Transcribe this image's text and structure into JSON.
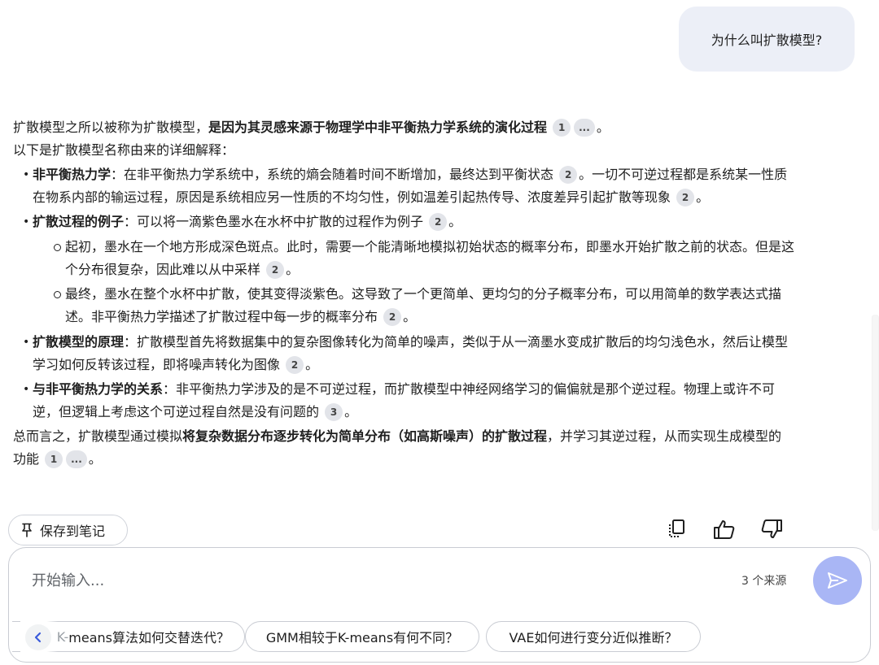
{
  "user_question": "为什么叫扩散模型?",
  "answer": {
    "intro": {
      "text1": "扩散模型之所以被称为扩散模型，",
      "bold1": "是因为其灵感来源于物理学中非平衡热力学系统的演化过程",
      "cite1": "1",
      "cite2": "...",
      "end": "。"
    },
    "lead": "以下是扩散模型名称由来的详细解释：",
    "items": [
      {
        "title": "非平衡热力学",
        "text": "：在非平衡热力学系统中，系统的熵会随着时间不断增加，最终达到平衡状态",
        "cite": "2",
        "text2": "。一切不可逆过程都是系统某一性质在物系内部的输运过程，原因是系统相应另一性质的不均匀性，例如温差引起热传导、浓度差异引起扩散等现象",
        "cite2": "2",
        "end": "。"
      },
      {
        "title": "扩散过程的例子",
        "text": "：可以将一滴紫色墨水在水杯中扩散的过程作为例子",
        "cite": "2",
        "end": "。",
        "subitems": [
          {
            "text": "起初，墨水在一个地方形成深色斑点。此时，需要一个能清晰地模拟初始状态的概率分布，即墨水开始扩散之前的状态。但是这个分布很复杂，因此难以从中采样",
            "cite": "2",
            "end": "。"
          },
          {
            "text": "最终，墨水在整个水杯中扩散，使其变得淡紫色。这导致了一个更简单、更均匀的分子概率分布，可以用简单的数学表达式描述。非平衡热力学描述了扩散过程中每一步的概率分布",
            "cite": "2",
            "end": "。"
          }
        ]
      },
      {
        "title": "扩散模型的原理",
        "text": "：扩散模型首先将数据集中的复杂图像转化为简单的噪声，类似于从一滴墨水变成扩散后的均匀浅色水，然后让模型学习如何反转该过程，即将噪声转化为图像",
        "cite": "2",
        "end": "。"
      },
      {
        "title": "与非平衡热力学的关系",
        "text": "：非平衡热力学涉及的是不可逆过程，而扩散模型中神经网络学习的偏偏就是那个逆过程。物理上或许不可逆，但逻辑上考虑这个可逆过程自然是没有问题的",
        "cite": "3",
        "end": "。"
      }
    ],
    "summary": {
      "text1": "总而言之，扩散模型通过模拟",
      "bold": "将复杂数据分布逐步转化为简单分布（如高斯噪声）的扩散过程",
      "text2": "，并学习其逆过程，从而实现生成模型的功能",
      "cite1": "1",
      "cite2": "...",
      "end": "。"
    }
  },
  "actions": {
    "save_note": "保存到笔记"
  },
  "composer": {
    "placeholder": "开始输入...",
    "source_count": "3 个来源"
  },
  "suggestions": [
    {
      "fade": "K-",
      "label": "means算法如何交替迭代？"
    },
    {
      "label": "GMM相较于K-means有何不同？"
    },
    {
      "label": "VAE如何进行变分近似推断？"
    }
  ],
  "colors": {
    "send_button": "#a9b6f5",
    "user_bubble": "#eceff7",
    "citation_chip": "#e2e4e9"
  },
  "icons": [
    "pin-icon",
    "copy-icon",
    "thumbs-up-icon",
    "thumbs-down-icon",
    "send-icon",
    "chevron-left-icon"
  ]
}
